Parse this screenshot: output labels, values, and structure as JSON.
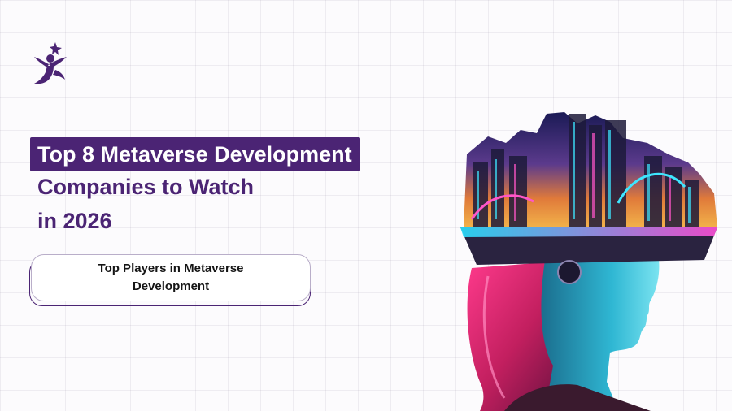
{
  "logo": {
    "icon": "figure-star-icon",
    "color": "#4b2474"
  },
  "heading": {
    "highlight": "Top 8 Metaverse Development",
    "line2": "Companies to Watch",
    "line3": "in 2026"
  },
  "subtitle": "Top Players in Metaverse Development",
  "hero_image": {
    "description": "woman-with-vr-headset-city-illustration"
  },
  "colors": {
    "accent": "#4b2474",
    "background": "#fcfbfd",
    "text": "#151515"
  }
}
